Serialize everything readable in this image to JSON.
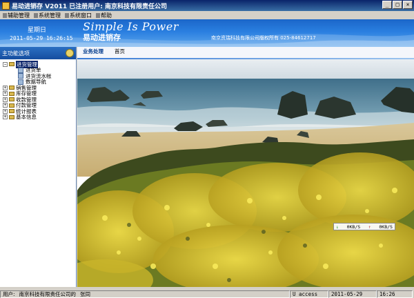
{
  "window": {
    "title": "易动进销存 V2011 已注册用户: 南京科技有限责任公司",
    "controls": [
      "_",
      "□",
      "×"
    ]
  },
  "menu": {
    "items": [
      "辅助管理",
      "系统管理",
      "系统窗口",
      "帮助"
    ]
  },
  "banner": {
    "weekday": "星期日",
    "datetime": "2011-05-29  16:26:15",
    "slogan": "Simple Is Power",
    "app_name": "易动进销存",
    "copyright": "南京资瑞科技有限公司版权所有  025-84612717"
  },
  "left_panel": {
    "header": "主功能选项",
    "tree": [
      {
        "label": "进货管理",
        "expanded": true,
        "selected": true,
        "children": [
          "进货单",
          "进货流水帐",
          "数据导航"
        ]
      },
      {
        "label": "销售管理"
      },
      {
        "label": "库存管理"
      },
      {
        "label": "收款管理"
      },
      {
        "label": "付款管理"
      },
      {
        "label": "统计报表"
      },
      {
        "label": "基本信息"
      }
    ]
  },
  "main": {
    "tabs": [
      "业务处理",
      "首页"
    ],
    "active_tab": 0
  },
  "netspeed": {
    "down": "0KB/S",
    "up": "0KB/S"
  },
  "status": {
    "user_label": "用户:",
    "company": "南京科技有限责任公司的",
    "user_name": "张同",
    "access": "U access",
    "date": "2011-05-29",
    "time": "16:26"
  },
  "colors": {
    "title_bar": "#0a246a",
    "banner": "#2a7fe0",
    "selection": "#0a246a"
  }
}
